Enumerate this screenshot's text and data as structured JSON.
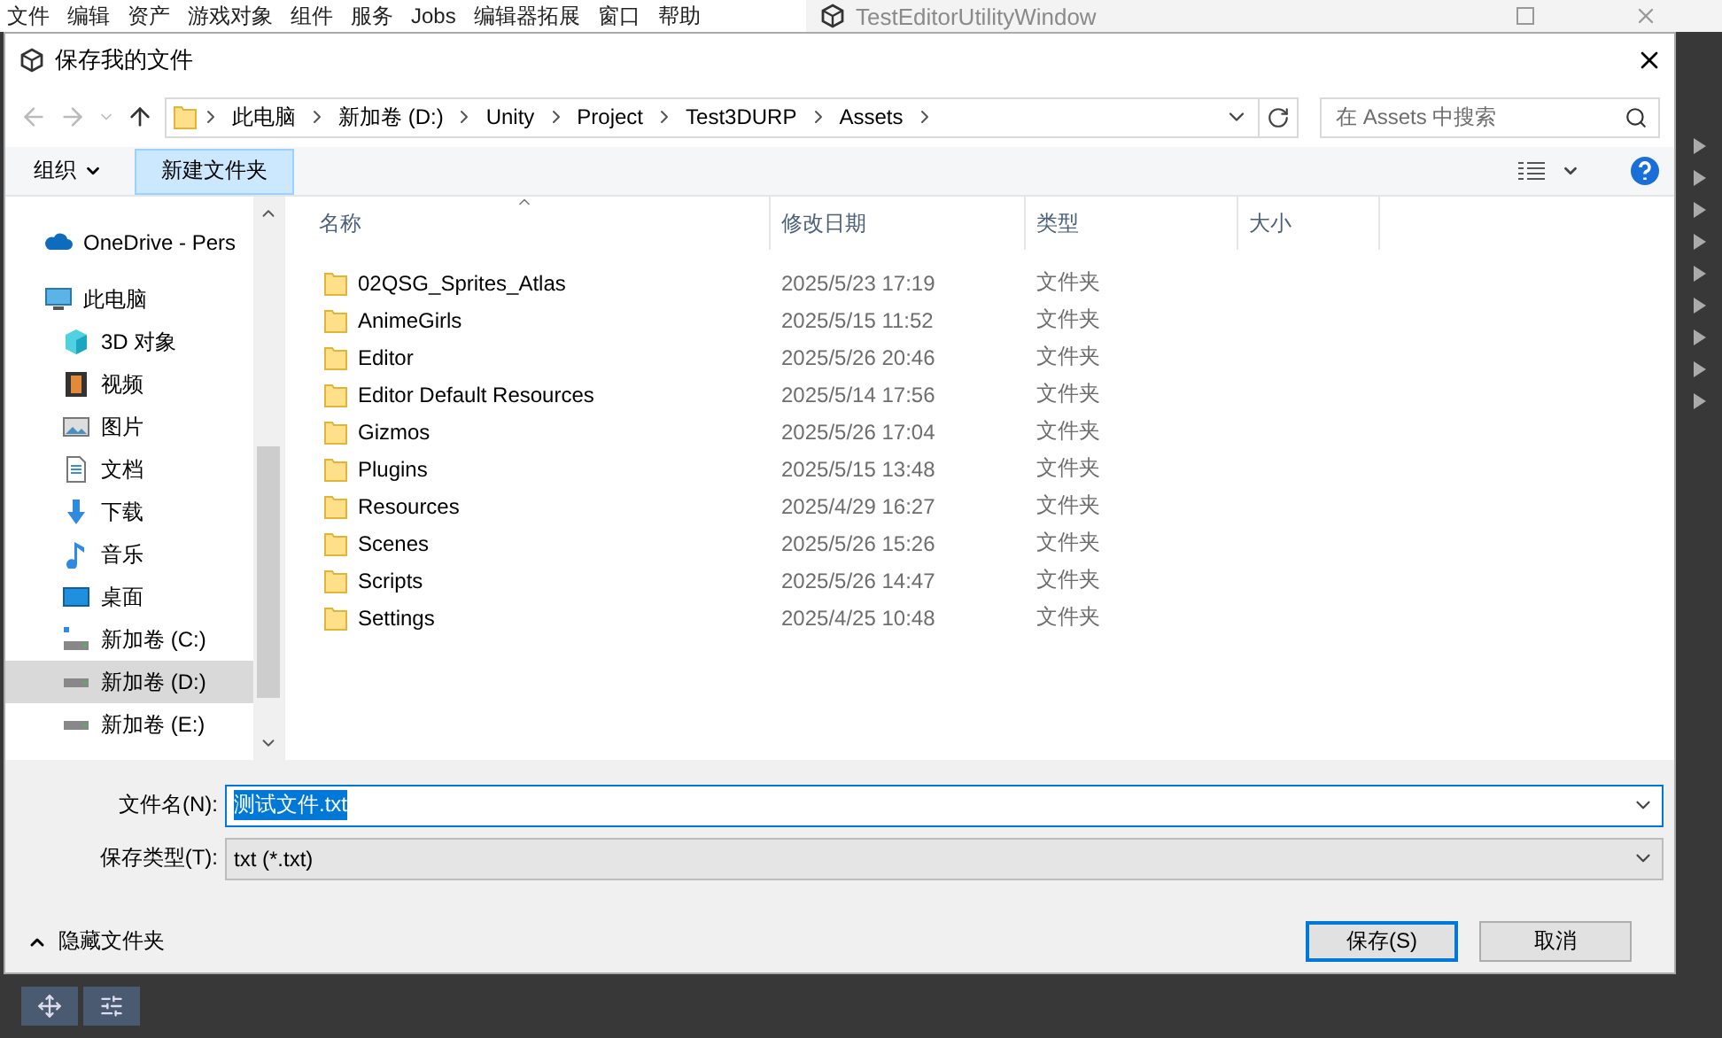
{
  "menu_bar": {
    "items": [
      "文件",
      "编辑",
      "资产",
      "游戏对象",
      "组件",
      "服务",
      "Jobs",
      "编辑器拓展",
      "窗口",
      "帮助"
    ]
  },
  "background_window": {
    "title": "TestEditorUtilityWindow"
  },
  "dialog": {
    "title": "保存我的文件",
    "breadcrumbs": [
      "此电脑",
      "新加卷 (D:)",
      "Unity",
      "Project",
      "Test3DURP",
      "Assets"
    ],
    "search": {
      "placeholder": "在 Assets 中搜索"
    },
    "toolbar": {
      "organize": "组织",
      "new_folder": "新建文件夹"
    },
    "nav_pane": [
      {
        "label": "OneDrive - Pers",
        "kind": "onedrive",
        "selected": false
      },
      {
        "label": "此电脑",
        "kind": "pc",
        "selected": false,
        "children": [
          {
            "label": "3D 对象",
            "kind": "cube",
            "selected": false
          },
          {
            "label": "视频",
            "kind": "video",
            "selected": false
          },
          {
            "label": "图片",
            "kind": "picture",
            "selected": false
          },
          {
            "label": "文档",
            "kind": "document",
            "selected": false
          },
          {
            "label": "下载",
            "kind": "download",
            "selected": false
          },
          {
            "label": "音乐",
            "kind": "music",
            "selected": false
          },
          {
            "label": "桌面",
            "kind": "desktop",
            "selected": false
          },
          {
            "label": "新加卷 (C:)",
            "kind": "system-drive",
            "selected": false
          },
          {
            "label": "新加卷 (D:)",
            "kind": "drive",
            "selected": true
          },
          {
            "label": "新加卷 (E:)",
            "kind": "drive",
            "selected": false
          }
        ]
      }
    ],
    "columns": [
      {
        "label": "名称",
        "sorted": true
      },
      {
        "label": "修改日期",
        "sorted": false
      },
      {
        "label": "类型",
        "sorted": false
      },
      {
        "label": "大小",
        "sorted": false
      }
    ],
    "rows": [
      {
        "name": "02QSG_Sprites_Atlas",
        "modified": "2025/5/23 17:19",
        "type": "文件夹"
      },
      {
        "name": "AnimeGirls",
        "modified": "2025/5/15 11:52",
        "type": "文件夹"
      },
      {
        "name": "Editor",
        "modified": "2025/5/26 20:46",
        "type": "文件夹"
      },
      {
        "name": "Editor Default Resources",
        "modified": "2025/5/14 17:56",
        "type": "文件夹"
      },
      {
        "name": "Gizmos",
        "modified": "2025/5/26 17:04",
        "type": "文件夹"
      },
      {
        "name": "Plugins",
        "modified": "2025/5/15 13:48",
        "type": "文件夹"
      },
      {
        "name": "Resources",
        "modified": "2025/4/29 16:27",
        "type": "文件夹"
      },
      {
        "name": "Scenes",
        "modified": "2025/5/26 15:26",
        "type": "文件夹"
      },
      {
        "name": "Scripts",
        "modified": "2025/5/26 14:47",
        "type": "文件夹"
      },
      {
        "name": "Settings",
        "modified": "2025/4/25 10:48",
        "type": "文件夹"
      }
    ],
    "filename": {
      "label": "文件名(N):",
      "value": "测试文件.txt",
      "text_selected": true
    },
    "filetype": {
      "label": "保存类型(T):",
      "value": "txt (*.txt)"
    },
    "hide_folders": "隐藏文件夹",
    "buttons": [
      {
        "label": "保存(S)",
        "default": true
      },
      {
        "label": "取消",
        "default": false
      }
    ]
  }
}
